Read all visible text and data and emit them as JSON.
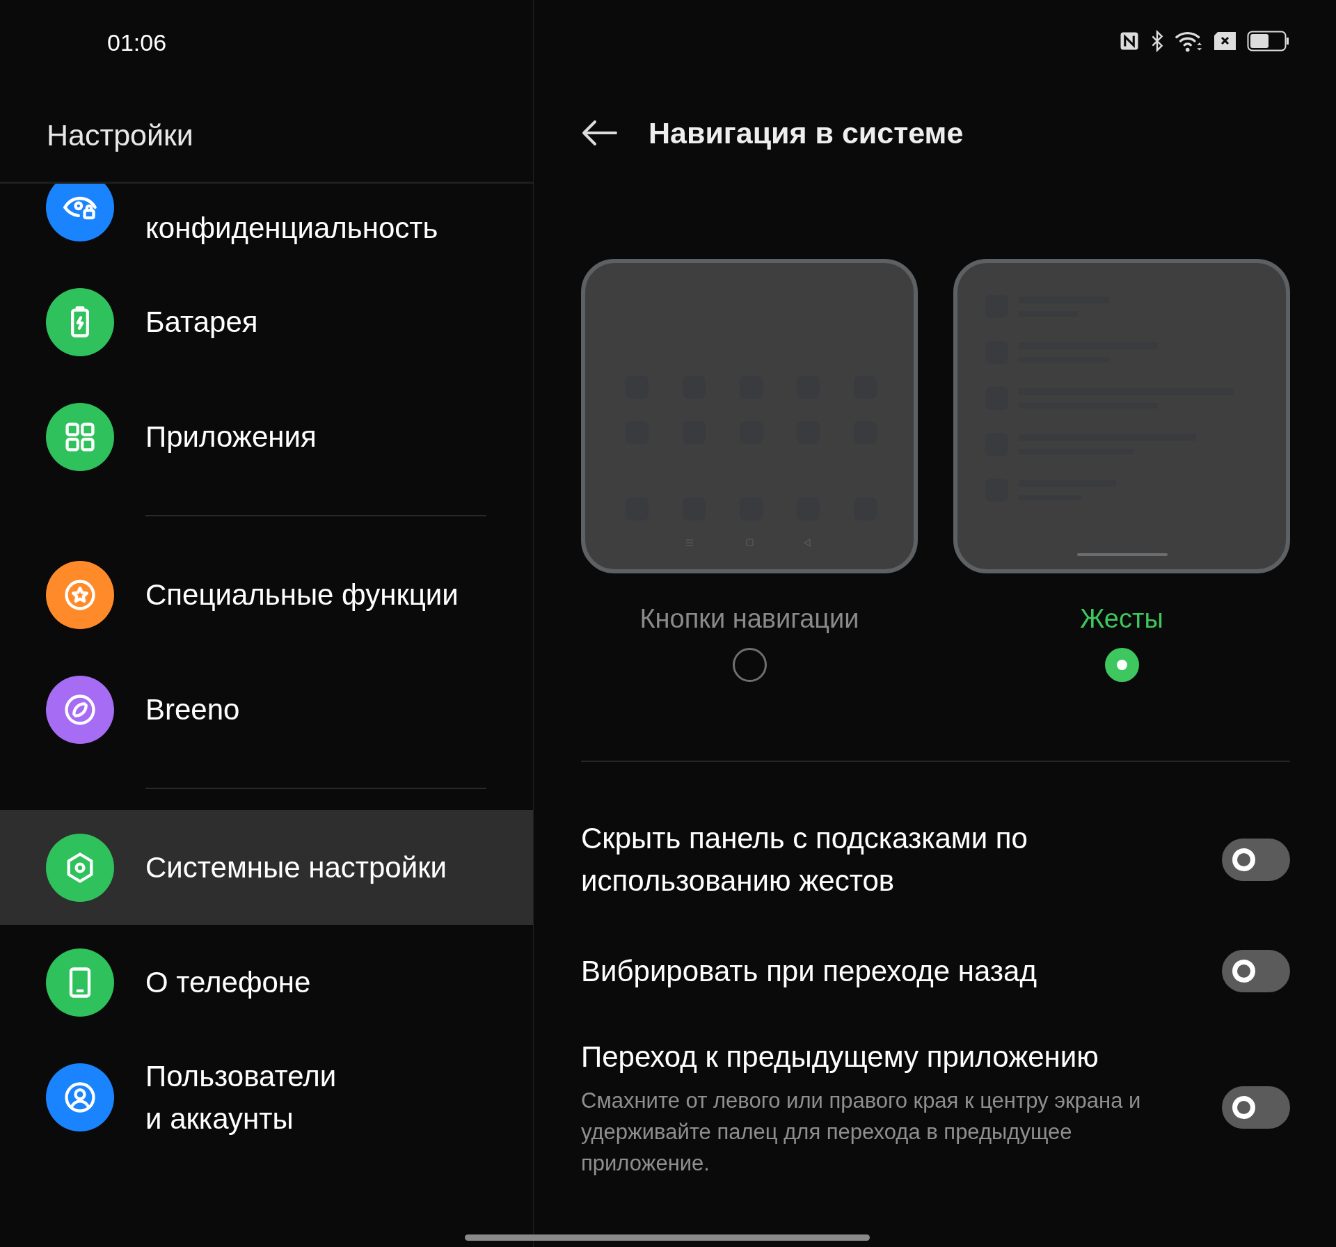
{
  "status_bar": {
    "time": "01:06"
  },
  "sidebar": {
    "title": "Настройки",
    "groups": [
      [
        {
          "label": "конфиденциальность",
          "kind": "privacy",
          "color": "#1a84ff",
          "selected": false
        },
        {
          "label": "Батарея",
          "kind": "battery",
          "color": "#2fc15b",
          "selected": false
        },
        {
          "label": "Приложения",
          "kind": "apps",
          "color": "#2fc15b",
          "selected": false
        }
      ],
      [
        {
          "label": "Специальные функции",
          "kind": "star",
          "color": "#ff8a2a",
          "selected": false
        },
        {
          "label": "Breeno",
          "kind": "breeno",
          "color": "#a66cf4",
          "selected": false
        }
      ],
      [
        {
          "label": "Системные настройки",
          "kind": "system",
          "color": "#2fc15b",
          "selected": true
        },
        {
          "label": "О телефоне",
          "kind": "phone",
          "color": "#2fc15b",
          "selected": false
        },
        {
          "label": "Пользователи\nи аккаунты",
          "kind": "user",
          "color": "#1a84ff",
          "selected": false
        }
      ]
    ]
  },
  "detail": {
    "title": "Навигация в системе",
    "nav_modes": [
      {
        "label": "Кнопки навигации",
        "kind": "buttons",
        "selected": false
      },
      {
        "label": "Жесты",
        "kind": "gestures",
        "selected": true
      }
    ],
    "options": [
      {
        "title": "Скрыть панель с подсказками по использованию жестов",
        "on": false
      },
      {
        "title": "Вибрировать при переходе назад",
        "on": false
      },
      {
        "title": "Переход к предыдущему приложению",
        "description": "Смахните от левого или правого края к центру экрана и удерживайте палец для перехода в предыдущее приложение.",
        "on": false
      }
    ]
  }
}
